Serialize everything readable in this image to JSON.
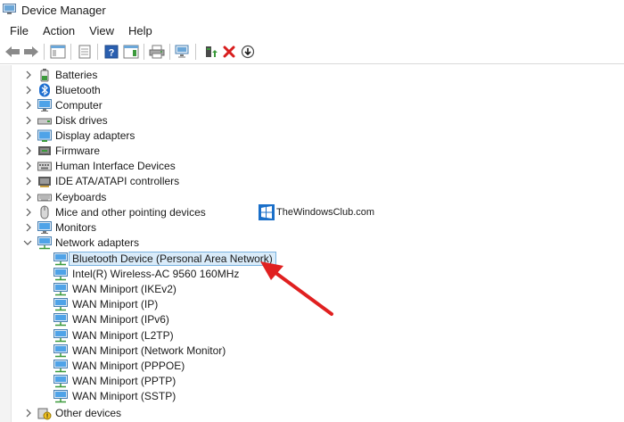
{
  "window": {
    "title": "Device Manager",
    "icon": "device-manager-icon"
  },
  "menu": [
    "File",
    "Action",
    "View",
    "Help"
  ],
  "toolbar": [
    {
      "name": "back-icon"
    },
    {
      "name": "forward-icon"
    },
    {
      "name": "show-hide-console-tree-icon"
    },
    {
      "name": "properties-icon"
    },
    {
      "name": "help-icon"
    },
    {
      "name": "action-pane-icon"
    },
    {
      "name": "print-icon"
    },
    {
      "name": "scan-hardware-icon"
    },
    {
      "name": "update-driver-icon"
    },
    {
      "name": "uninstall-device-icon"
    },
    {
      "name": "disable-device-icon"
    }
  ],
  "tree": {
    "categories": [
      {
        "label": "Batteries",
        "icon": "battery-icon"
      },
      {
        "label": "Bluetooth",
        "icon": "bluetooth-icon"
      },
      {
        "label": "Computer",
        "icon": "computer-icon"
      },
      {
        "label": "Disk drives",
        "icon": "disk-drive-icon"
      },
      {
        "label": "Display adapters",
        "icon": "display-adapter-icon"
      },
      {
        "label": "Firmware",
        "icon": "firmware-icon"
      },
      {
        "label": "Human Interface Devices",
        "icon": "hid-icon"
      },
      {
        "label": "IDE ATA/ATAPI controllers",
        "icon": "ide-controller-icon"
      },
      {
        "label": "Keyboards",
        "icon": "keyboard-icon"
      },
      {
        "label": "Mice and other pointing devices",
        "icon": "mouse-icon"
      },
      {
        "label": "Monitors",
        "icon": "monitor-icon"
      },
      {
        "label": "Network adapters",
        "icon": "network-adapter-icon",
        "expanded": true
      },
      {
        "label": "Other devices",
        "icon": "other-devices-icon"
      }
    ],
    "network_children": [
      {
        "label": "Bluetooth Device (Personal Area Network)",
        "selected": true
      },
      {
        "label": "Intel(R) Wireless-AC 9560 160MHz"
      },
      {
        "label": "WAN Miniport (IKEv2)"
      },
      {
        "label": "WAN Miniport (IP)"
      },
      {
        "label": "WAN Miniport (IPv6)"
      },
      {
        "label": "WAN Miniport (L2TP)"
      },
      {
        "label": "WAN Miniport (Network Monitor)"
      },
      {
        "label": "WAN Miniport (PPPOE)"
      },
      {
        "label": "WAN Miniport (PPTP)"
      },
      {
        "label": "WAN Miniport (SSTP)"
      }
    ]
  },
  "watermark": {
    "text": "TheWindowsClub.com"
  },
  "annotation": {
    "color": "#e02020",
    "icon": "red-arrow-icon"
  }
}
